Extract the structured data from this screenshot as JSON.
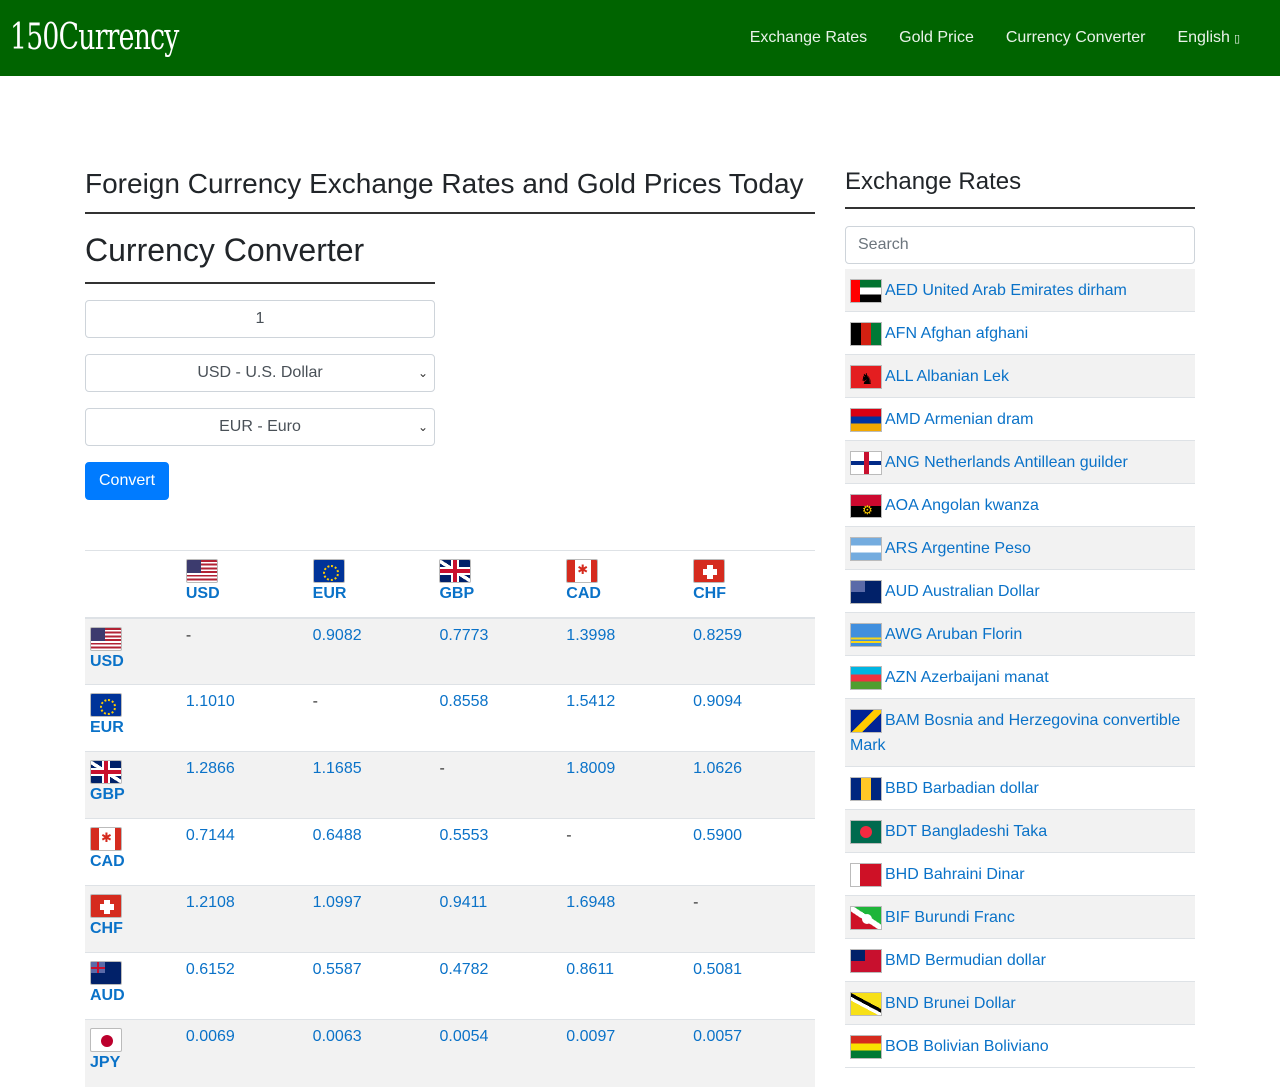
{
  "navbar": {
    "brand": "150Currency",
    "links": [
      "Exchange Rates",
      "Gold Price",
      "Currency Converter"
    ],
    "language": "English",
    "language_caret": "▯"
  },
  "main": {
    "page_title": "Foreign Currency Exchange Rates and Gold Prices Today",
    "converter": {
      "title": "Currency Converter",
      "amount_value": "1",
      "from_selected": "USD - U.S. Dollar",
      "to_selected": "EUR - Euro",
      "button_label": "Convert"
    },
    "rate_table": {
      "columns": [
        "USD",
        "EUR",
        "GBP",
        "CAD",
        "CHF"
      ],
      "rows": [
        {
          "code": "USD",
          "values": [
            "-",
            "0.9082",
            "0.7773",
            "1.3998",
            "0.8259"
          ]
        },
        {
          "code": "EUR",
          "values": [
            "1.1010",
            "-",
            "0.8558",
            "1.5412",
            "0.9094"
          ]
        },
        {
          "code": "GBP",
          "values": [
            "1.2866",
            "1.1685",
            "-",
            "1.8009",
            "1.0626"
          ]
        },
        {
          "code": "CAD",
          "values": [
            "0.7144",
            "0.6488",
            "0.5553",
            "-",
            "0.5900"
          ]
        },
        {
          "code": "CHF",
          "values": [
            "1.2108",
            "1.0997",
            "0.9411",
            "1.6948",
            "-"
          ]
        },
        {
          "code": "AUD",
          "values": [
            "0.6152",
            "0.5587",
            "0.4782",
            "0.8611",
            "0.5081"
          ]
        },
        {
          "code": "JPY",
          "values": [
            "0.0069",
            "0.0063",
            "0.0054",
            "0.0097",
            "0.0057"
          ]
        }
      ]
    }
  },
  "sidebar": {
    "title": "Exchange Rates",
    "search_placeholder": "Search",
    "currencies": [
      {
        "code": "AED",
        "name": "AED United Arab Emirates dirham"
      },
      {
        "code": "AFN",
        "name": "AFN Afghan afghani"
      },
      {
        "code": "ALL",
        "name": "ALL Albanian Lek"
      },
      {
        "code": "AMD",
        "name": "AMD Armenian dram"
      },
      {
        "code": "ANG",
        "name": "ANG Netherlands Antillean guilder"
      },
      {
        "code": "AOA",
        "name": "AOA Angolan kwanza"
      },
      {
        "code": "ARS",
        "name": "ARS Argentine Peso"
      },
      {
        "code": "AUD",
        "name": "AUD Australian Dollar"
      },
      {
        "code": "AWG",
        "name": "AWG Aruban Florin"
      },
      {
        "code": "AZN",
        "name": "AZN Azerbaijani manat"
      },
      {
        "code": "BAM",
        "name": "BAM Bosnia and Herzegovina convertible Mark"
      },
      {
        "code": "BBD",
        "name": "BBD Barbadian dollar"
      },
      {
        "code": "BDT",
        "name": "BDT Bangladeshi Taka"
      },
      {
        "code": "BHD",
        "name": "BHD Bahraini Dinar"
      },
      {
        "code": "BIF",
        "name": "BIF Burundi Franc"
      },
      {
        "code": "BMD",
        "name": "BMD Bermudian dollar"
      },
      {
        "code": "BND",
        "name": "BND Brunei Dollar"
      },
      {
        "code": "BOB",
        "name": "BOB Bolivian Boliviano"
      }
    ]
  },
  "colors": {
    "navbar_bg": "#006400",
    "link": "#0a72c8",
    "button": "#007bff"
  },
  "icons": {
    "dropdown": "chevron-down-icon",
    "flags": "flag-icon"
  }
}
